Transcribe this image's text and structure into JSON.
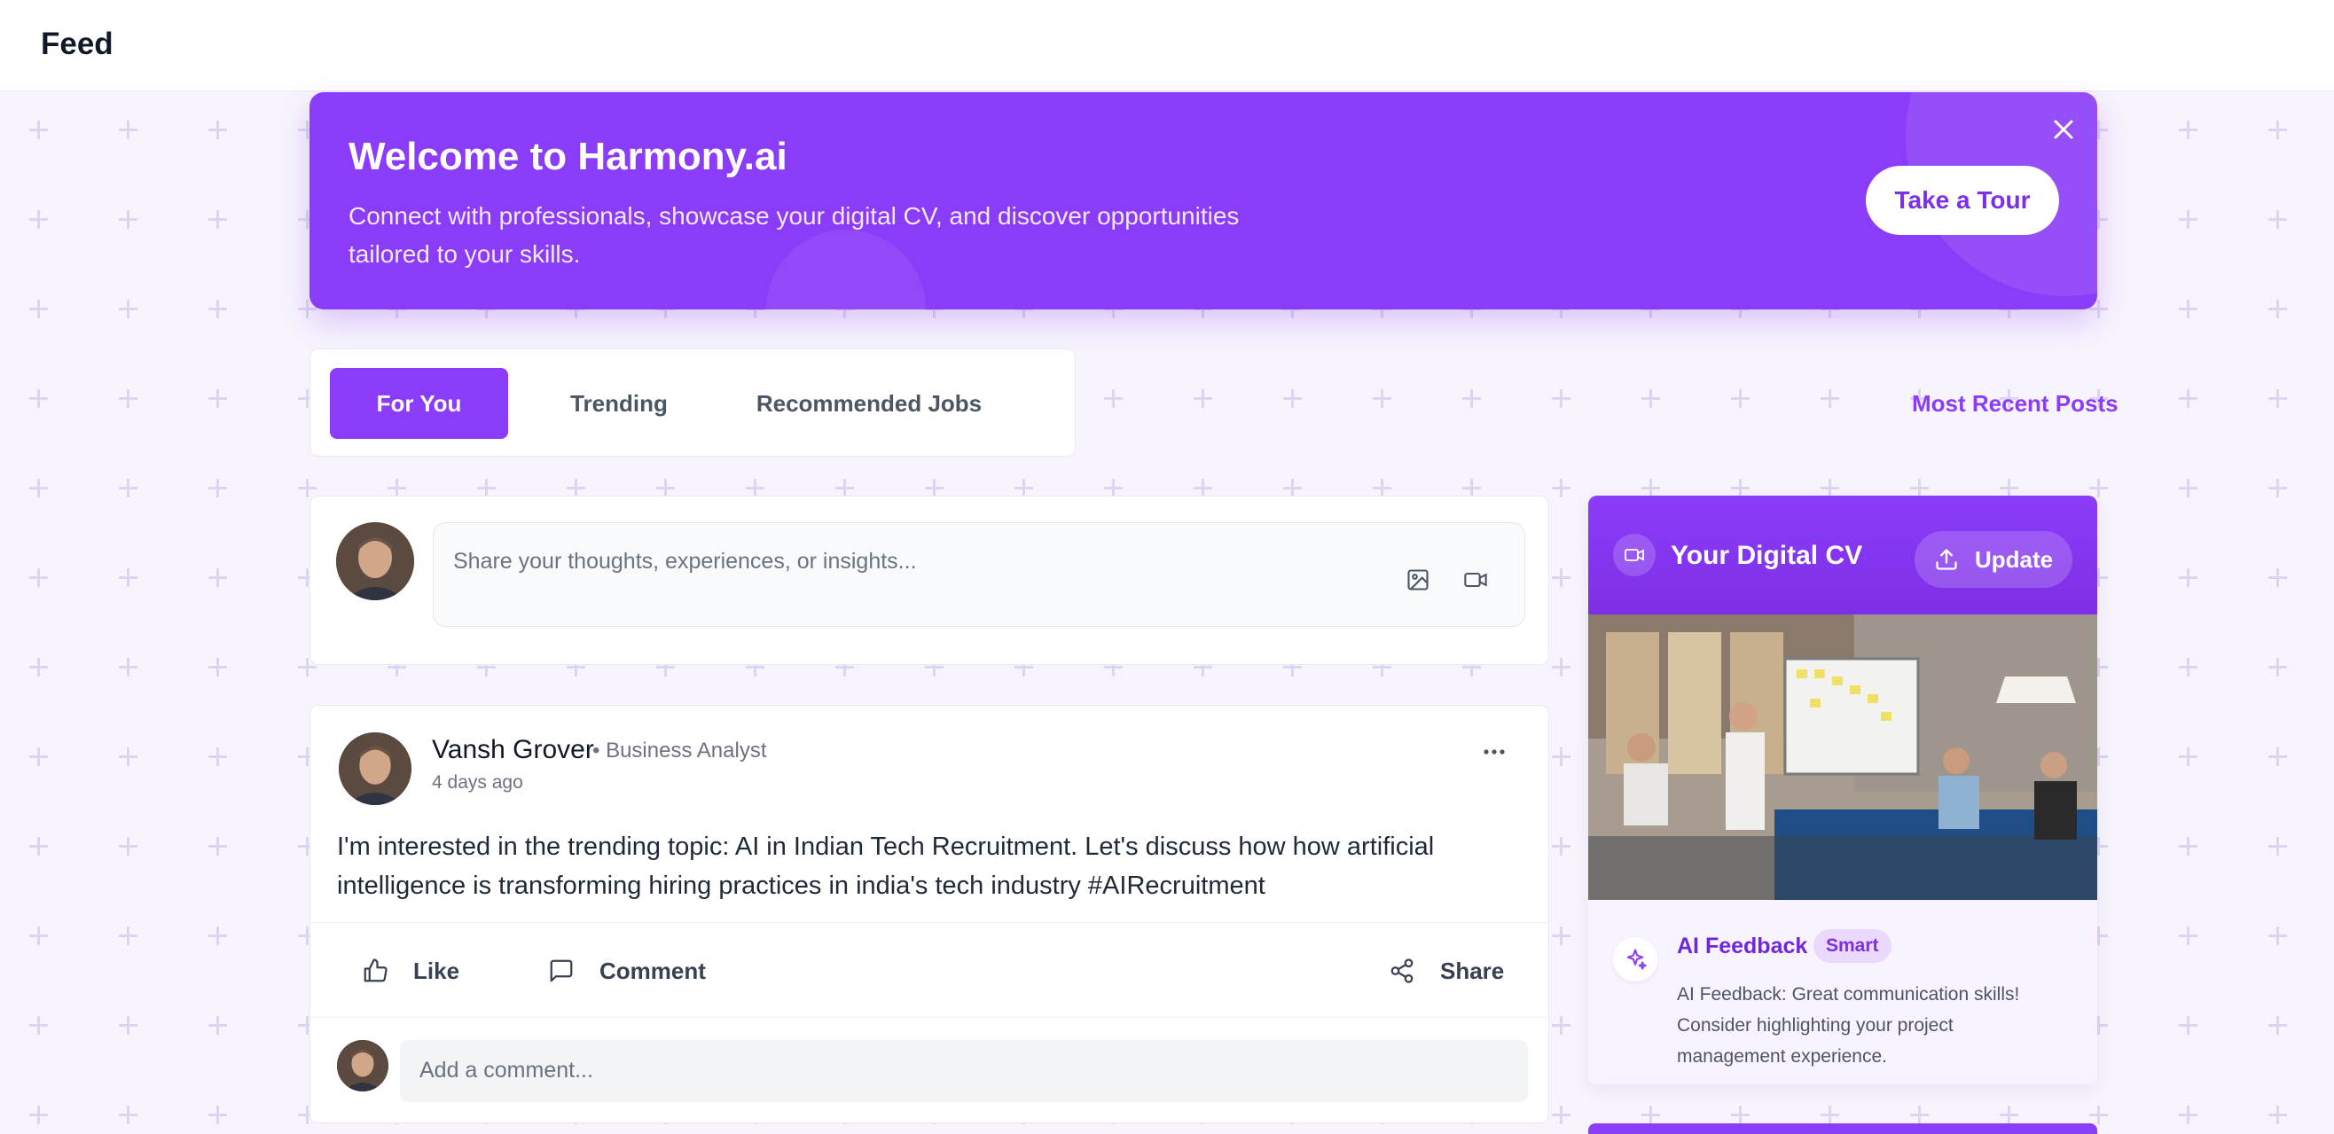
{
  "header": {
    "title": "Feed"
  },
  "banner": {
    "title": "Welcome to Harmony.ai",
    "subtitle": "Connect with professionals, showcase your digital CV, and discover opportunities tailored to your skills.",
    "tour_label": "Take a Tour"
  },
  "tabs": [
    {
      "label": "For You",
      "active": true
    },
    {
      "label": "Trending",
      "active": false
    },
    {
      "label": "Recommended Jobs",
      "active": false
    }
  ],
  "sort_label": "Most Recent Posts",
  "composer": {
    "placeholder": "Share your thoughts, experiences, or insights..."
  },
  "post": {
    "author": "Vansh Grover",
    "role": "• Business Analyst",
    "time": "4 days ago",
    "body": "I'm interested in the trending topic: AI in Indian Tech Recruitment. Let's discuss how how artificial intelligence is transforming hiring practices in india's tech industry #AIRecruitment",
    "like_label": "Like",
    "comment_label": "Comment",
    "share_label": "Share",
    "comment_placeholder": "Add a comment..."
  },
  "digital_cv": {
    "title": "Your Digital CV",
    "update_label": "Update",
    "feedback_label": "AI Feedback",
    "feedback_badge": "Smart",
    "feedback_text": "AI Feedback: Great communication skills! Consider highlighting your project management experience."
  },
  "colors": {
    "accent": "#8b3cf8",
    "background": "#f7f4fd"
  }
}
